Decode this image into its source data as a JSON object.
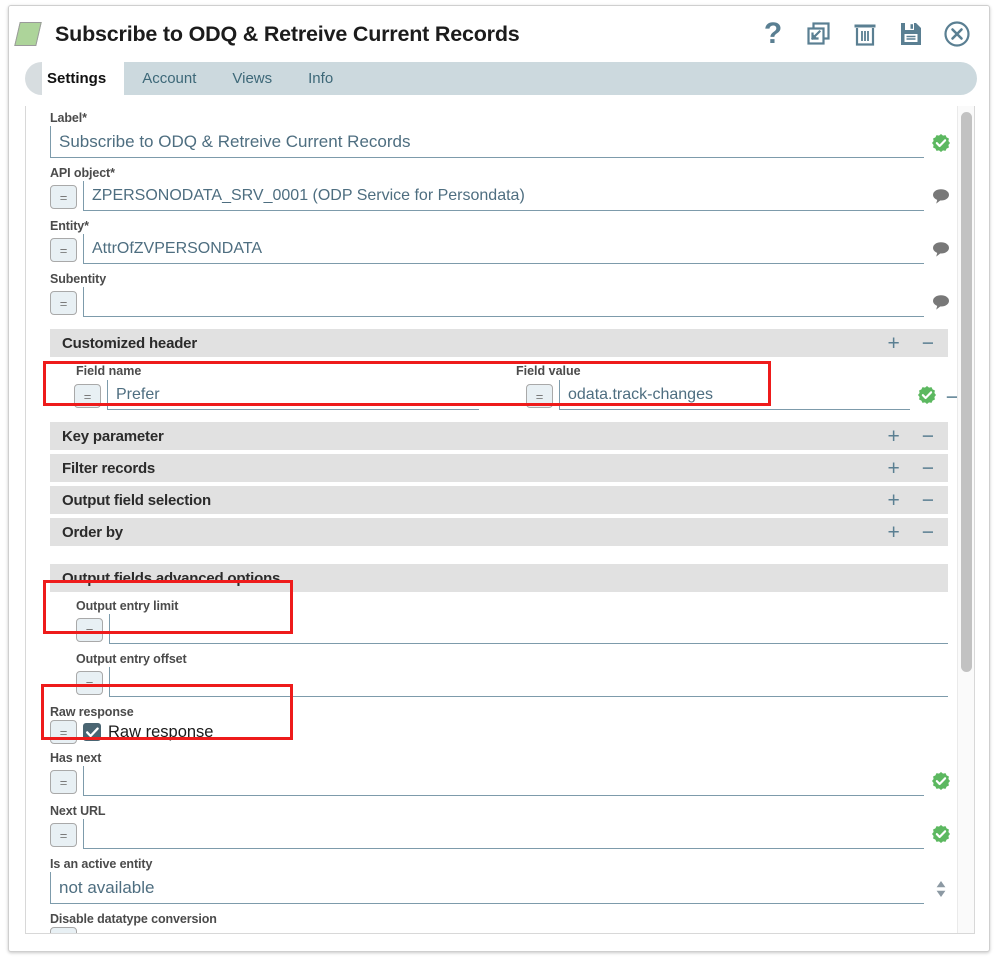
{
  "window": {
    "title": "Subscribe to ODQ & Retreive Current Records",
    "app_icon": "parallelogram-icon",
    "title_icons": [
      {
        "name": "help-icon",
        "glyph": "?"
      },
      {
        "name": "restore-window-icon",
        "glyph": "restore"
      },
      {
        "name": "delete-icon",
        "glyph": "trash"
      },
      {
        "name": "save-icon",
        "glyph": "floppy"
      },
      {
        "name": "close-icon",
        "glyph": "x-circle"
      }
    ]
  },
  "tabs": [
    {
      "label": "Settings",
      "active": true
    },
    {
      "label": "Account",
      "active": false
    },
    {
      "label": "Views",
      "active": false
    },
    {
      "label": "Info",
      "active": false
    }
  ],
  "form": {
    "label_field": {
      "label": "Label*",
      "value": "Subscribe to ODQ & Retreive Current Records",
      "status": "valid"
    },
    "api_object": {
      "label": "API object*",
      "value": "ZPERSONODATA_SRV_0001 (ODP Service for Persondata)",
      "formula_toggle": "=",
      "end_icon": "comment-icon"
    },
    "entity": {
      "label": "Entity*",
      "value": "AttrOfZVPERSONDATA",
      "formula_toggle": "=",
      "end_icon": "comment-icon"
    },
    "subentity": {
      "label": "Subentity",
      "value": "",
      "formula_toggle": "=",
      "end_icon": "comment-icon"
    },
    "customized_header": {
      "title": "Customized header",
      "add": "+",
      "remove": "−",
      "col_field_name": "Field name",
      "col_field_value": "Field value",
      "rows": [
        {
          "field_name": "Prefer",
          "field_value": "odata.track-changes",
          "status": "valid",
          "row_remove": "−"
        }
      ]
    },
    "collapsed_sections": [
      {
        "title": "Key parameter",
        "add": "+",
        "remove": "−"
      },
      {
        "title": "Filter records",
        "add": "+",
        "remove": "−"
      },
      {
        "title": "Output field selection",
        "add": "+",
        "remove": "−"
      },
      {
        "title": "Order by",
        "add": "+",
        "remove": "−"
      }
    ],
    "advanced": {
      "title": "Output fields advanced options",
      "output_entry_limit": {
        "label": "Output entry limit",
        "value": "",
        "formula_toggle": "="
      },
      "output_entry_offset": {
        "label": "Output entry offset",
        "value": "",
        "formula_toggle": "="
      },
      "raw_response": {
        "label": "Raw response",
        "checkbox_label": "Raw response",
        "checked": true,
        "formula_toggle": "="
      },
      "has_next": {
        "label": "Has next",
        "value": "",
        "formula_toggle": "=",
        "status": "valid"
      },
      "next_url": {
        "label": "Next URL",
        "value": "",
        "formula_toggle": "=",
        "status": "valid"
      },
      "is_active_entity": {
        "label": "Is an active entity",
        "value": "not available",
        "control": "spinner"
      },
      "disable_datatype_conversion": {
        "label": "Disable datatype conversion"
      }
    }
  },
  "highlights": [
    {
      "name": "highlight-customized-header-row"
    },
    {
      "name": "highlight-output-entry-limit"
    },
    {
      "name": "highlight-raw-response"
    }
  ],
  "colors": {
    "accent": "#5a7f92",
    "valid_badge": "#5cb860",
    "highlight": "#ee1b1b",
    "section_bar": "#e1e1e1",
    "tab_bar": "#ccd9de",
    "app_icon": "#add49a"
  }
}
